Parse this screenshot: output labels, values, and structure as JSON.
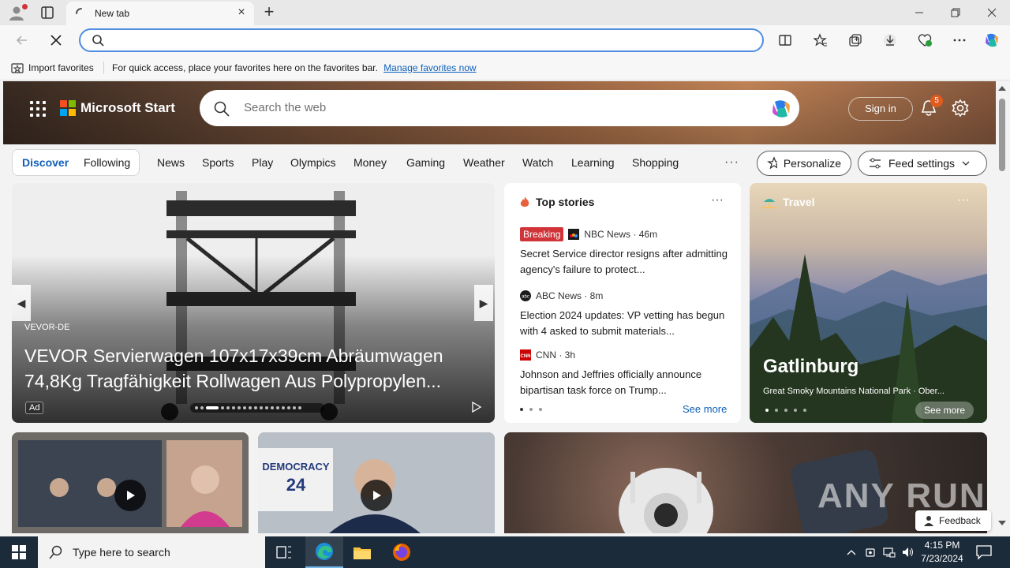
{
  "browser": {
    "tab_title": "New tab",
    "address_value": "",
    "address_placeholder": ""
  },
  "favorites_bar": {
    "import_label": "Import favorites",
    "message": "For quick access, place your favorites here on the favorites bar.",
    "manage_link": "Manage favorites now"
  },
  "msn": {
    "brand": "Microsoft Start",
    "search_placeholder": "Search the web",
    "sign_in": "Sign in",
    "notification_count": "5",
    "feed_tabs": {
      "discover": "Discover",
      "following": "Following"
    },
    "categories": [
      "News",
      "Sports",
      "Play",
      "Olympics",
      "Money",
      "Gaming",
      "Weather",
      "Watch",
      "Learning",
      "Shopping"
    ],
    "more": "···",
    "personalize": "Personalize",
    "feed_settings": "Feed settings"
  },
  "ad_card": {
    "source": "VEVOR-DE",
    "headline": "VEVOR Servierwagen 107x17x39cm Abräumwagen 74,8Kg Tragfähigkeit Rollwagen Aus Polypropylen...",
    "ad_label": "Ad"
  },
  "top_stories": {
    "heading": "Top stories",
    "menu": "···",
    "items": [
      {
        "badge": "Breaking",
        "source": "NBC News · 46m",
        "title": "Secret Service director resigns after admitting agency's failure to protect..."
      },
      {
        "badge": "",
        "source": "ABC News · 8m",
        "title": "Election 2024 updates: VP vetting has begun with 4 asked to submit materials..."
      },
      {
        "badge": "",
        "source": "CNN · 3h",
        "title": "Johnson and Jeffries officially announce bipartisan task force on Trump..."
      }
    ],
    "see_more": "See more"
  },
  "travel": {
    "heading": "Travel",
    "menu": "···",
    "place": "Gatlinburg",
    "caption": "Great Smoky Mountains National Park · Ober...",
    "see_more": "See more"
  },
  "video_cards": [
    {
      "image_text_1": "DEMOCRACY",
      "image_text_2": "24"
    }
  ],
  "watermark": "ANY RUN",
  "feedback": "Feedback",
  "taskbar": {
    "search_placeholder": "Type here to search",
    "time": "4:15 PM",
    "date": "7/23/2024"
  },
  "colors": {
    "accent_blue": "#0f5fb8",
    "breaking_red": "#d13438",
    "omnibox_focus": "#4f8de3",
    "taskbar_bg": "#1c2b3a"
  }
}
